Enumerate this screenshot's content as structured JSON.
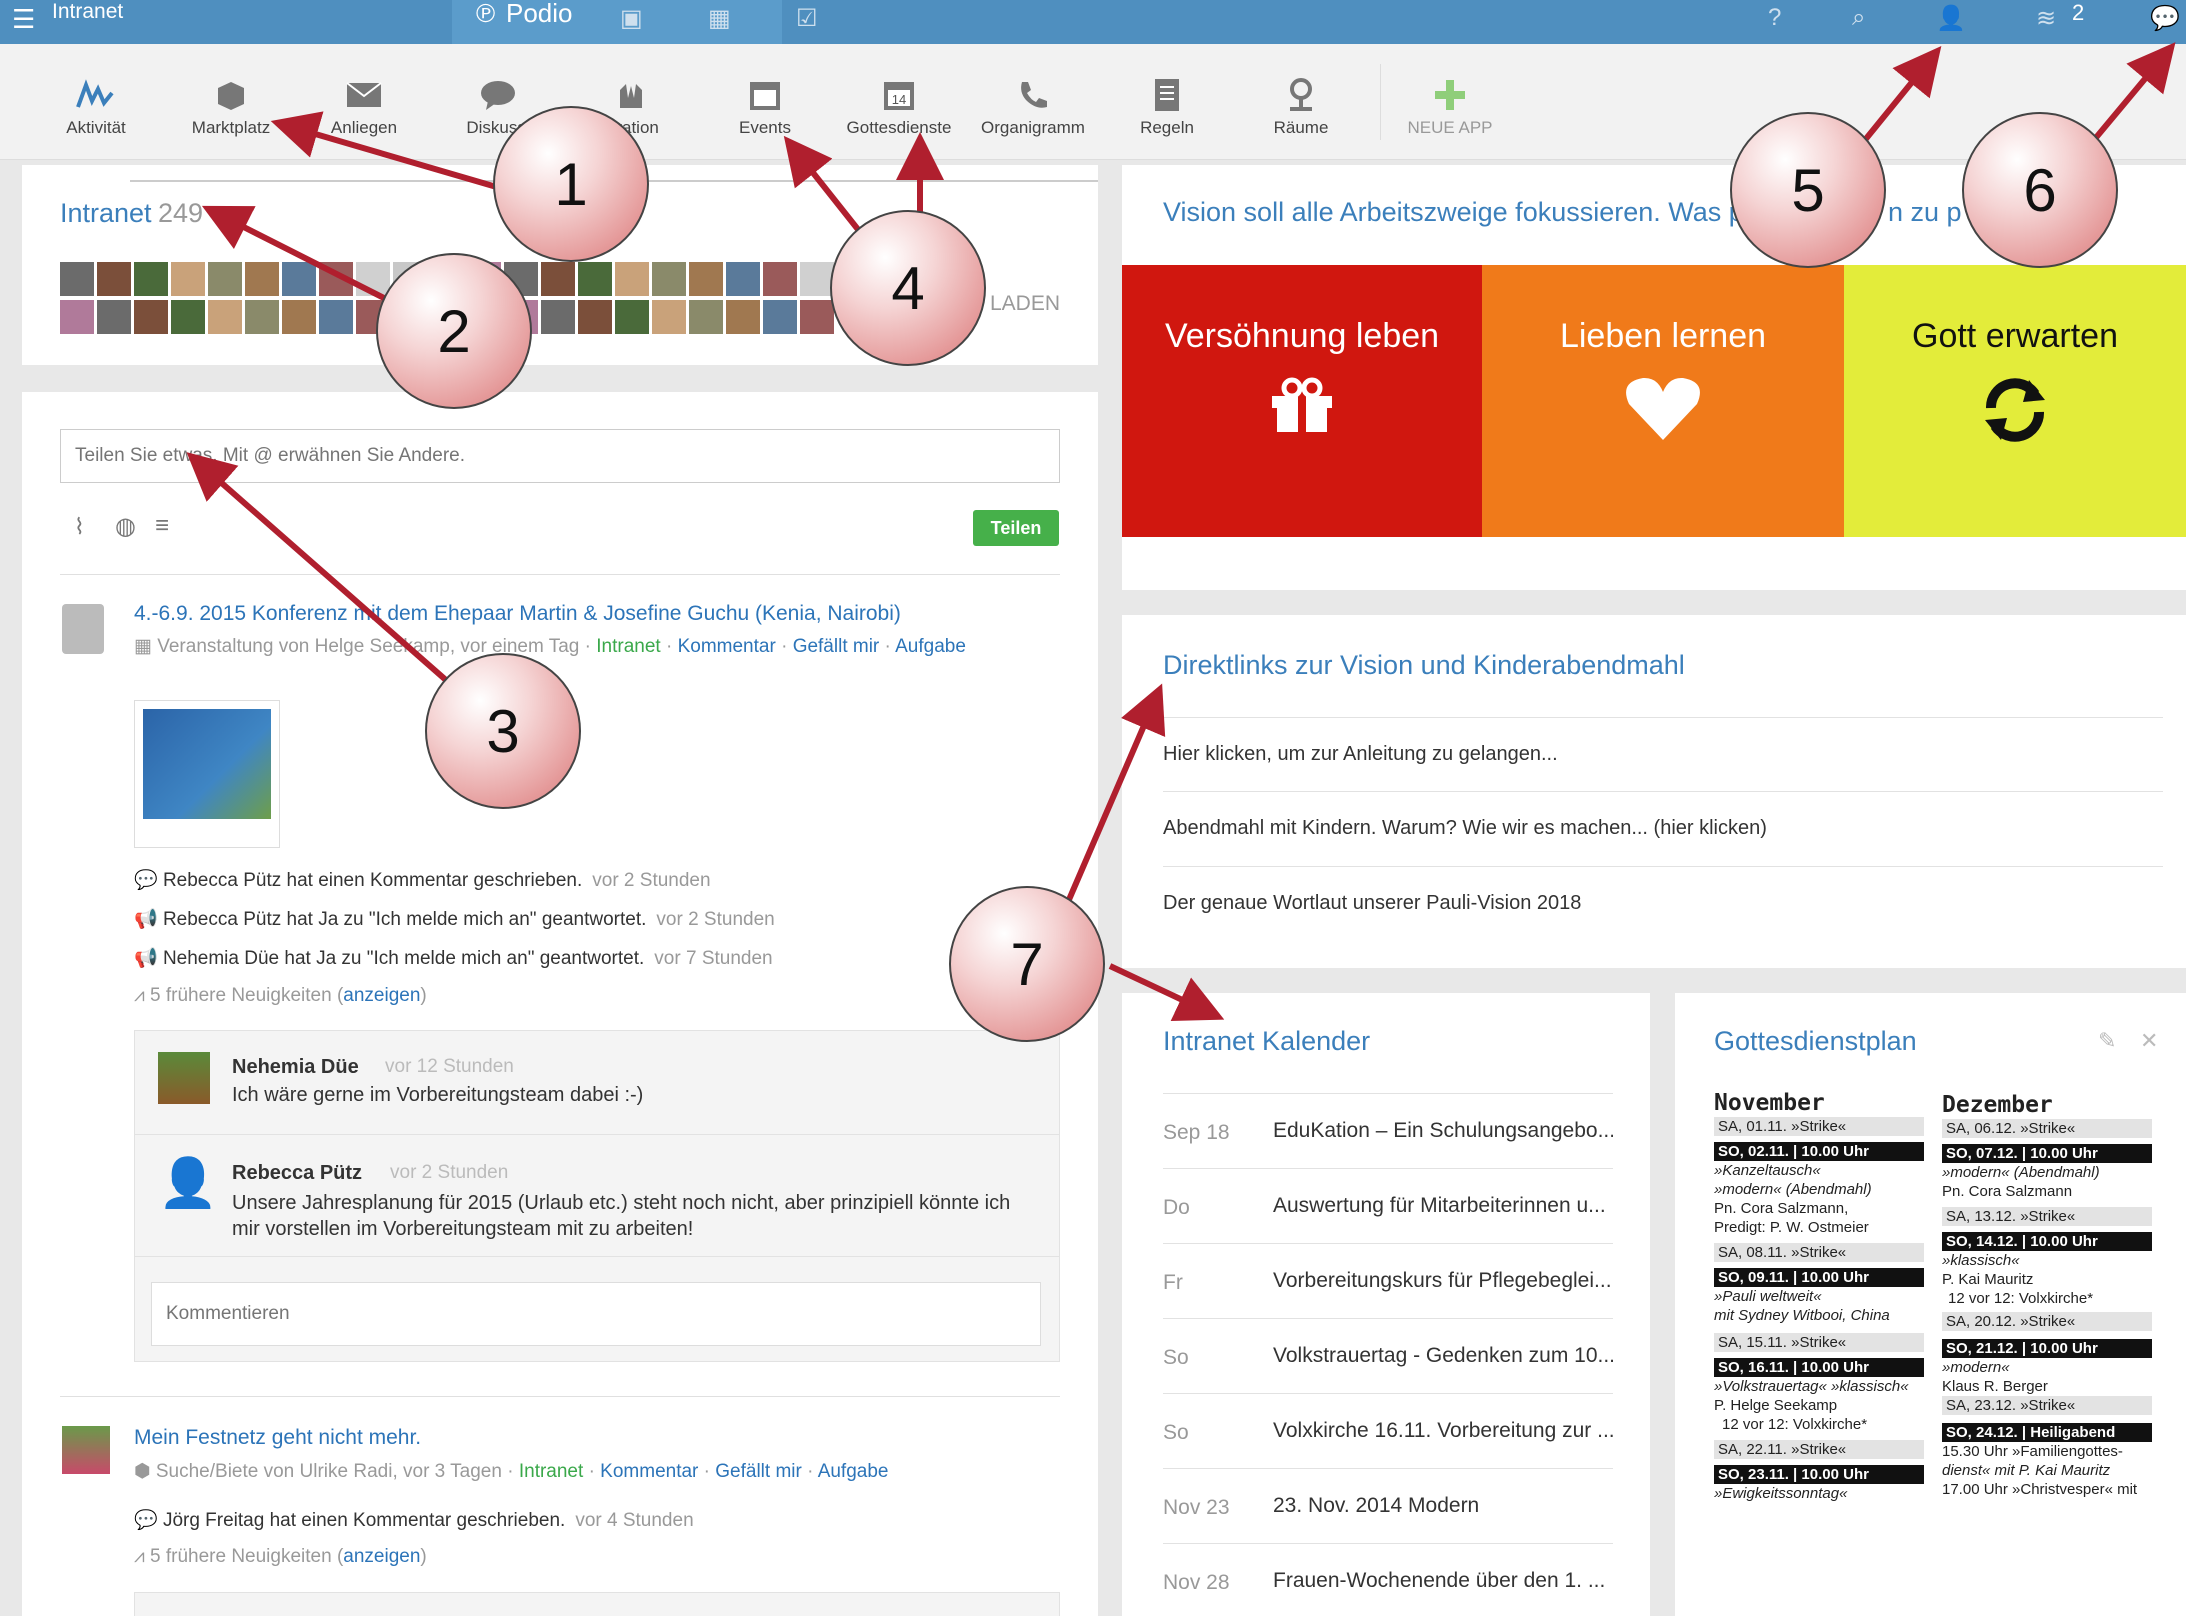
{
  "topbar": {
    "workspace": "Intranet",
    "brand": "Podio",
    "notif_count": "2"
  },
  "apps": [
    {
      "label": "Aktivität"
    },
    {
      "label": "Marktplatz"
    },
    {
      "label": "Anliegen"
    },
    {
      "label": "Diskussi"
    },
    {
      "label": "piration"
    },
    {
      "label": "Events"
    },
    {
      "label": "Gottesdienste"
    },
    {
      "label": "Organigramm"
    },
    {
      "label": "Regeln"
    },
    {
      "label": "Räume"
    },
    {
      "label": "NEUE APP"
    }
  ],
  "members": {
    "title": "Intranet",
    "count": "249",
    "load_more": "LADEN"
  },
  "share": {
    "placeholder": "Teilen Sie etwas. Mit @ erwähnen Sie Andere.",
    "button": "Teilen"
  },
  "post1": {
    "title": "4.-6.9. 2015 Konferenz mit dem Ehepaar Martin & Josefine Guchu (Kenia, Nairobi)",
    "meta": "Veranstaltung von Helge Seekamp, vor einem Tag",
    "space": "Intranet",
    "comment": "Kommentar",
    "like": "Gefällt mir",
    "task": "Aufgabe",
    "activities": [
      {
        "text": "Rebecca Pütz hat einen Kommentar geschrieben.",
        "time": "vor 2 Stunden"
      },
      {
        "text": "Rebecca Pütz hat Ja zu \"Ich melde mich an\" geantwortet.",
        "time": "vor 2 Stunden"
      },
      {
        "text": "Nehemia Düe hat Ja zu \"Ich melde mich an\" geantwortet.",
        "time": "vor 7 Stunden"
      }
    ],
    "earlier": "5 frühere Neuigkeiten",
    "show": "anzeigen",
    "comments": [
      {
        "author": "Nehemia Düe",
        "time": "vor 12 Stunden",
        "text": "Ich wäre gerne im Vorbereitungsteam dabei :-)"
      },
      {
        "author": "Rebecca Pütz",
        "time": "vor 2 Stunden",
        "text": "Unsere Jahresplanung für 2015 (Urlaub etc.) steht noch nicht, aber prinzipiell könnte ich mir vorstellen im Vorbereitungsteam mit zu arbeiten!"
      }
    ],
    "comment_placeholder": "Kommentieren"
  },
  "post2": {
    "title": "Mein Festnetz geht nicht mehr.",
    "meta": "Suche/Biete von Ulrike Radi, vor 3 Tagen",
    "space": "Intranet",
    "comment": "Kommentar",
    "like": "Gefällt mir",
    "task": "Aufgabe",
    "activity": {
      "text": "Jörg Freitag hat einen Kommentar geschrieben.",
      "time": "vor 4 Stunden"
    },
    "earlier": "5 frühere Neuigkeiten",
    "show": "anzeigen"
  },
  "vision": {
    "headline": "Vision soll alle Arbeitszweige fokussieren. Was pa",
    "headline_tail": "n zu p",
    "tiles": [
      {
        "label": "Versöhnung leben",
        "color": "#d0170f"
      },
      {
        "label": "Lieben lernen",
        "color": "#f07a1a"
      },
      {
        "label": "Gott erwarten",
        "color": "#e3ec3a"
      }
    ]
  },
  "direktlinks": {
    "title": "Direktlinks zur Vision und Kinderabendmahl",
    "links": [
      "Hier klicken, um zur Anleitung zu gelangen...",
      "Abendmahl mit Kindern. Warum? Wie wir es machen... (hier klicken)",
      "Der genaue Wortlaut unserer Pauli-Vision 2018"
    ]
  },
  "kalender": {
    "title": "Intranet Kalender",
    "events": [
      {
        "date": "Sep 18",
        "title": "EduKation – Ein Schulungsangebo..."
      },
      {
        "date": "Do",
        "title": "Auswertung für Mitarbeiterinnen u..."
      },
      {
        "date": "Fr",
        "title": "Vorbereitungskurs für Pflegebeglei..."
      },
      {
        "date": "So",
        "title": "Volkstrauertag - Gedenken zum 10..."
      },
      {
        "date": "So",
        "title": "Volxkirche 16.11. Vorbereitung zur ..."
      },
      {
        "date": "Nov 23",
        "title": "23. Nov. 2014 Modern"
      },
      {
        "date": "Nov 28",
        "title": "Frauen-Wochenende über den 1. ..."
      }
    ]
  },
  "gottesdienst": {
    "title": "Gottesdienstplan",
    "nov": {
      "month": "November",
      "l1": "SA, 01.11. »Strike«",
      "l2": "SO, 02.11. | 10.00 Uhr",
      "l3": "»Kanzeltausch«",
      "l4": "»modern« (Abendmahl)",
      "l5": "Pn. Cora Salzmann,",
      "l6": "Predigt: P. W. Ostmeier",
      "l7": "SA, 08.11. »Strike«",
      "l8": "SO, 09.11. | 10.00 Uhr",
      "l9": "»Pauli weltweit«",
      "l10": "mit Sydney Witbooi, China",
      "l11": "SA, 15.11. »Strike«",
      "l12": "SO, 16.11. | 10.00 Uhr",
      "l13": "»Volkstrauertag« »klassisch«",
      "l14": "P. Helge Seekamp",
      "l15": "12 vor 12: Volxkirche*",
      "l16": "SA, 22.11. »Strike«",
      "l17": "SO, 23.11. | 10.00 Uhr",
      "l18": "»Ewigkeitssonntag«"
    },
    "dez": {
      "month": "Dezember",
      "l1": "SA, 06.12. »Strike«",
      "l2": "SO, 07.12. | 10.00 Uhr",
      "l3": "»modern« (Abendmahl)",
      "l4": "Pn. Cora Salzmann",
      "l5": "SA, 13.12. »Strike«",
      "l6": "SO, 14.12. | 10.00 Uhr",
      "l7": "»klassisch«",
      "l8": "P. Kai Mauritz",
      "l9": "12 vor 12: Volxkirche*",
      "l10": "SA, 20.12. »Strike«",
      "l11": "SO, 21.12. | 10.00 Uhr",
      "l12": "»modern«",
      "l13": "Klaus R. Berger",
      "l14": "SA, 23.12. »Strike«",
      "l15": "SO, 24.12. | Heiligabend",
      "l16": "15.30 Uhr »Familiengottes-",
      "l17": "dienst« mit P. Kai Mauritz",
      "l18": "17.00 Uhr »Christvesper« mit"
    }
  },
  "callouts": [
    "1",
    "2",
    "3",
    "4",
    "5",
    "6",
    "7"
  ],
  "colors": {
    "topbar": "#4f8fbf",
    "link": "#2c74b8",
    "green": "#3aa84a",
    "arrow": "#b01f2e"
  }
}
